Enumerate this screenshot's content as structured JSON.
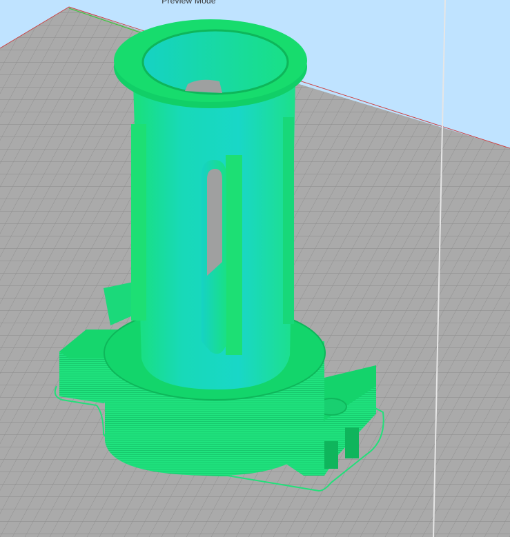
{
  "viewport": {
    "mode_label": "Preview Mode",
    "colors": {
      "sky": "#bfe3ff",
      "bed": "#a9a9a9",
      "grid": "#8f8f8f",
      "outer_wall": "#20e37e",
      "top_surface": "#12d86f",
      "inner_wall": "#16d4c0",
      "skirt": "#22e07a"
    }
  }
}
